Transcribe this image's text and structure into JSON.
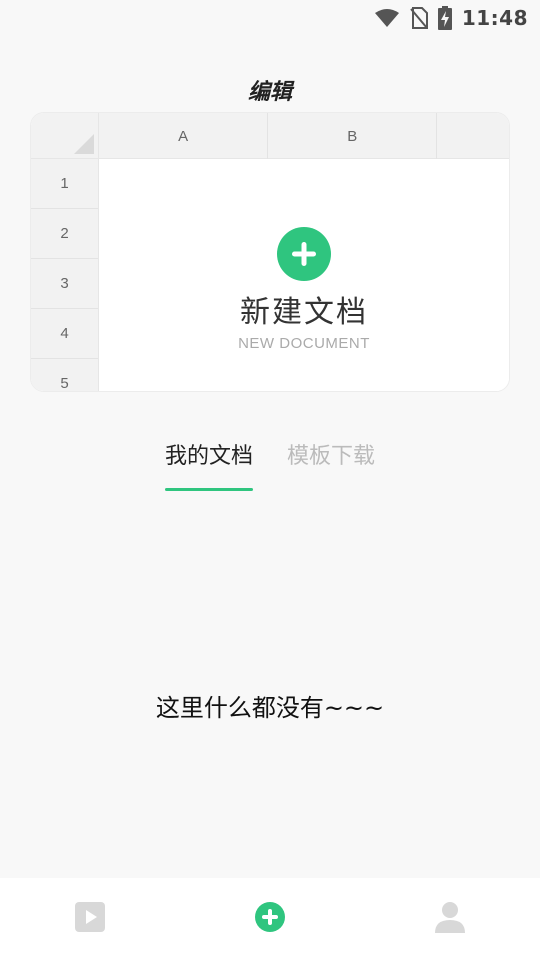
{
  "status_bar": {
    "time": "11:48",
    "icons": [
      "wifi-icon",
      "no-sim-icon",
      "battery-charging-icon"
    ]
  },
  "header": {
    "title": "编辑"
  },
  "spreadsheet": {
    "columns": [
      "A",
      "B",
      ""
    ],
    "rows": [
      "1",
      "2",
      "3",
      "4",
      "5"
    ],
    "new_document": {
      "icon": "plus-icon",
      "title": "新建文档",
      "subtitle": "NEW DOCUMENT"
    }
  },
  "tabs": [
    {
      "label": "我的文档",
      "active": true
    },
    {
      "label": "模板下载",
      "active": false
    }
  ],
  "empty_state": {
    "text": "这里什么都没有~~~"
  },
  "bottom_nav": {
    "items": [
      {
        "icon": "play-icon",
        "active": false
      },
      {
        "icon": "plus-icon",
        "active": true
      },
      {
        "icon": "user-icon",
        "active": false
      }
    ]
  },
  "colors": {
    "accent": "#2fc57f",
    "background": "#f8f8f8",
    "inactive": "#bbbbbb"
  }
}
